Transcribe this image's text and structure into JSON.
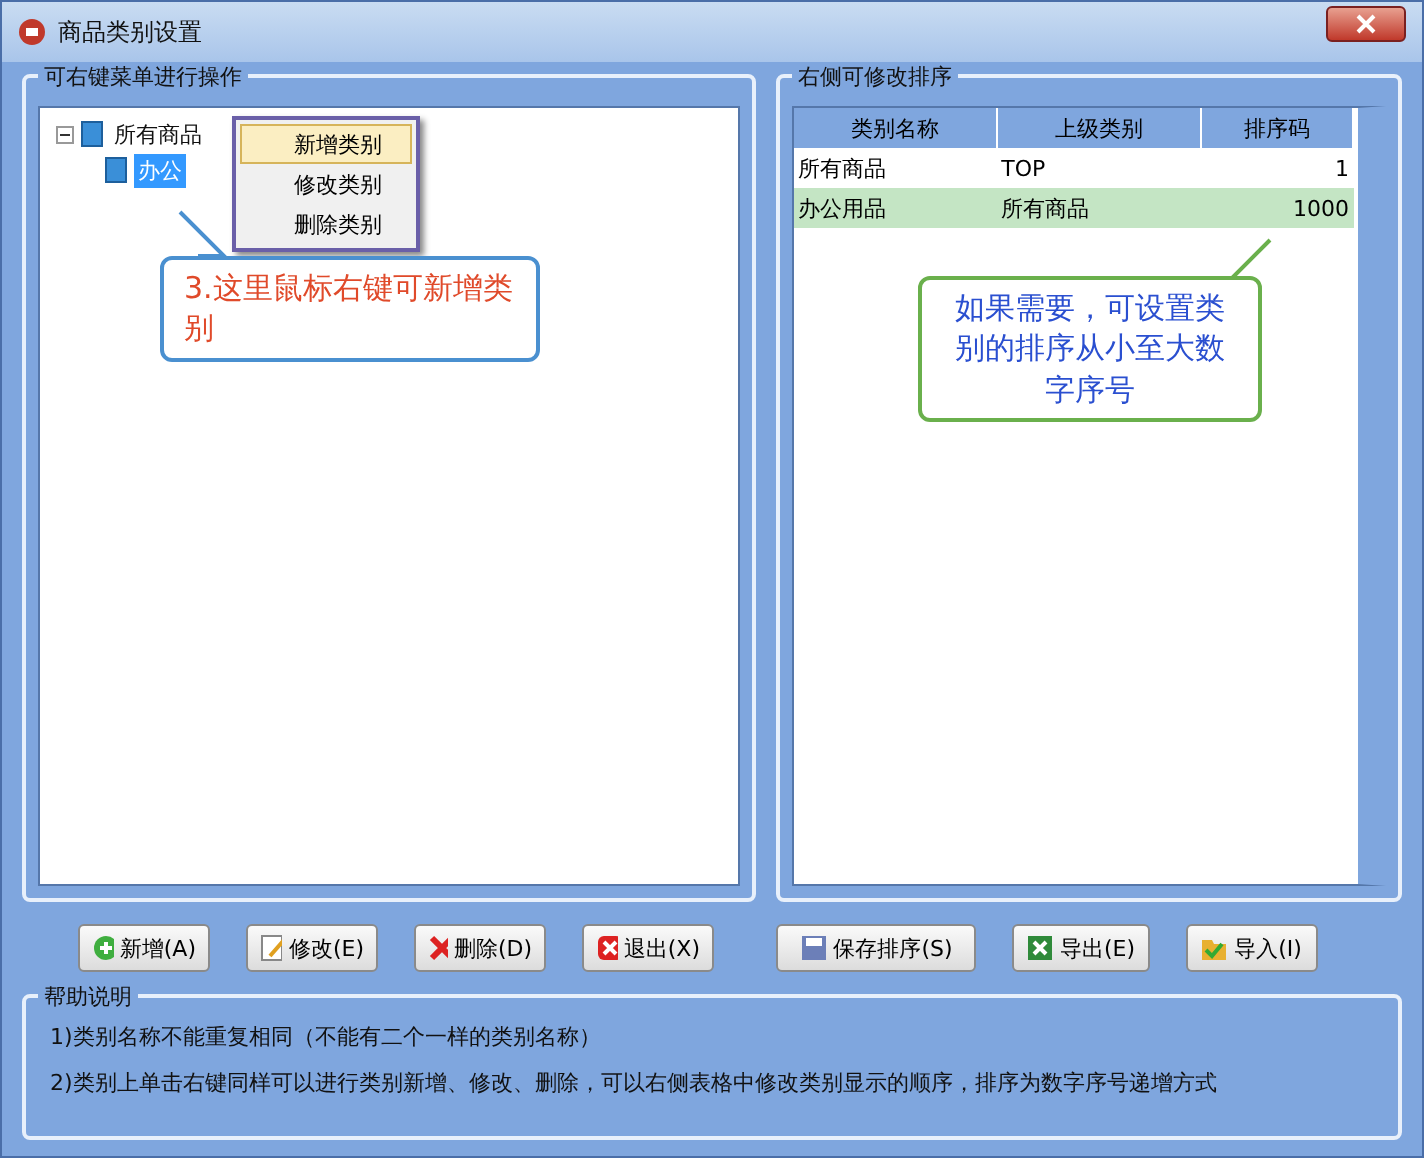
{
  "window": {
    "title": "商品类别设置"
  },
  "tree_panel": {
    "title": "可右键菜单进行操作",
    "tree": [
      {
        "label": "所有商品",
        "expanded": true,
        "selected": false,
        "children": [
          {
            "label": "办公",
            "selected": true
          }
        ]
      }
    ],
    "context_menu": [
      {
        "label": "新增类别",
        "selected": true
      },
      {
        "label": "修改类别",
        "selected": false
      },
      {
        "label": "删除类别",
        "selected": false
      }
    ],
    "callout": "3.这里鼠标右键可新增类别"
  },
  "sort_panel": {
    "title": "右侧可修改排序",
    "table": {
      "columns": [
        "类别名称",
        "上级类别",
        "排序码"
      ],
      "rows": [
        {
          "cells": [
            "所有商品",
            "TOP",
            "1"
          ],
          "selected": false
        },
        {
          "cells": [
            "办公用品",
            "所有商品",
            "1000"
          ],
          "selected": true
        }
      ]
    },
    "callout": "如果需要，可设置类别的排序从小至大数字序号"
  },
  "left_buttons": [
    {
      "label": "新增(A)"
    },
    {
      "label": "修改(E)"
    },
    {
      "label": "删除(D)"
    },
    {
      "label": "退出(X)"
    }
  ],
  "right_buttons": [
    {
      "label": "保存排序(S)"
    },
    {
      "label": "导出(E)"
    },
    {
      "label": "导入(I)"
    }
  ],
  "help": {
    "title": "帮助说明",
    "lines": [
      "1)类别名称不能重复相同（不能有二个一样的类别名称）",
      "2)类别上单击右键同样可以进行类别新增、修改、删除，可以右侧表格中修改类别显示的顺序，排序为数字序号递增方式"
    ]
  }
}
